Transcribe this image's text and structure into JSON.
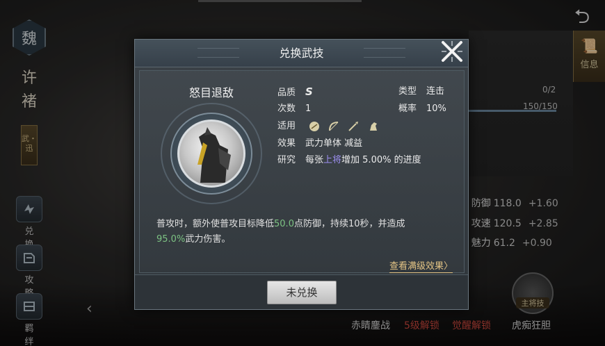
{
  "hero": {
    "faction": "魏",
    "name": "许褚",
    "tag": "武・迅"
  },
  "left_nav": [
    {
      "label": "兑换",
      "icon": "exchange-icon"
    },
    {
      "label": "攻略",
      "icon": "guide-icon"
    },
    {
      "label": "羁绊",
      "icon": "bond-icon"
    }
  ],
  "right_panel": {
    "info_tab": "信息",
    "progress_a": "0/2",
    "progress_b": "150/150",
    "stats": [
      {
        "name": "防御",
        "value": "118.0",
        "inc": "+1.60"
      },
      {
        "name": "攻速",
        "value": "120.5",
        "inc": "+2.85"
      },
      {
        "name": "魅力",
        "value": "61.2",
        "inc": "+0.90"
      }
    ],
    "skill_tag": "主将技",
    "bottom_labels": [
      {
        "text": "赤睛鏖战",
        "color": "#d8d8d8"
      },
      {
        "text": "5级解锁",
        "color": "#d24a3f"
      },
      {
        "text": "觉醒解锁",
        "color": "#d24a3f"
      },
      {
        "text": "虎痴狂胆",
        "color": "#d8d8d8"
      }
    ]
  },
  "modal": {
    "title": "兑换武技",
    "skill_name": "怒目退敌",
    "attributes": {
      "quality_label": "品质",
      "quality_value": "S",
      "type_label": "类型",
      "type_value": "连击",
      "count_label": "次数",
      "count_value": "1",
      "rate_label": "概率",
      "rate_value": "10%",
      "applies_label": "适用",
      "applies_icons": [
        "shield-icon",
        "bow-icon",
        "spear-icon",
        "horse-icon"
      ],
      "effect_label": "效果",
      "effect_value": "武力单体 减益",
      "research_label": "研究",
      "research_prefix": "每张",
      "research_highlight": "上将",
      "research_suffix": "增加 5.00% 的进度"
    },
    "description": {
      "part1": "普攻时，额外使普攻目标降低",
      "value1": "50.0",
      "part2": "点防御，持续10秒，并造成",
      "value2": "95.0%",
      "part3": "武力伤害。"
    },
    "view_full_link": "查看满级效果〉",
    "action_button": "未兑换"
  },
  "colors": {
    "accent_gold": "#e4c485",
    "highlight_green": "#7dc383",
    "highlight_purple": "#9c8ff0",
    "lock_red": "#d24a3f"
  }
}
